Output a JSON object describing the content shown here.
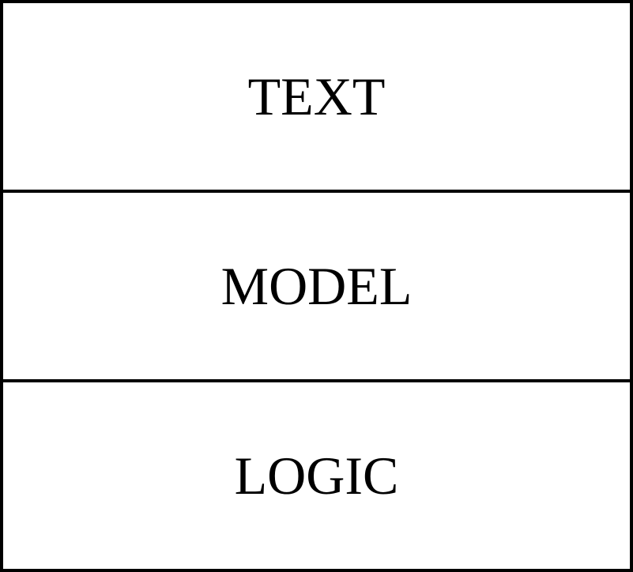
{
  "diagram": {
    "layers": [
      {
        "label": "TEXT"
      },
      {
        "label": "MODEL"
      },
      {
        "label": "LOGIC"
      }
    ],
    "colors": {
      "stroke": "#000000",
      "fill": "#ffffff",
      "text": "#000000"
    }
  }
}
